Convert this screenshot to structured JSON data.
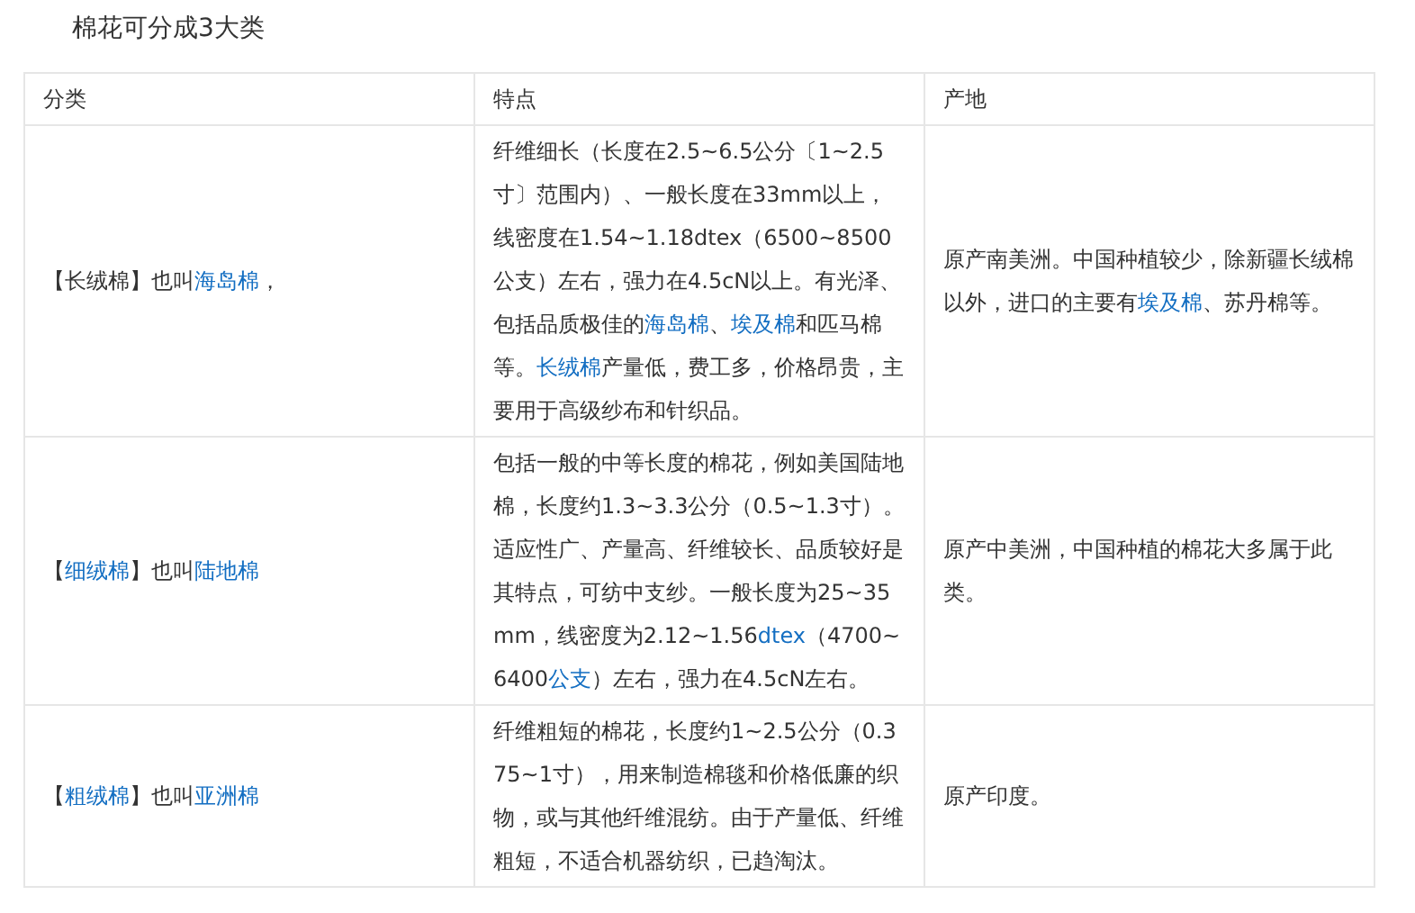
{
  "heading": "棉花可分成3大类",
  "table": {
    "columns": [
      "分类",
      "特点",
      "产地"
    ],
    "rows": [
      {
        "cells": [
          [
            {
              "text": "【长绒棉】也叫",
              "kind": "text"
            },
            {
              "text": "海岛棉",
              "kind": "link"
            },
            {
              "text": "，",
              "kind": "text"
            }
          ],
          [
            {
              "text": "纤维细长（长度在2.5~6.5公分〔1~2.5寸〕范围内）、一般长度在33mm以上，线密度在1.54~1.18dtex（6500~8500公支）左右，强力在4.5cN以上。有光泽、包括品质极佳的",
              "kind": "text"
            },
            {
              "text": "海岛棉",
              "kind": "link"
            },
            {
              "text": "、",
              "kind": "text"
            },
            {
              "text": "埃及棉",
              "kind": "link"
            },
            {
              "text": "和匹马棉等。",
              "kind": "text"
            },
            {
              "text": "长绒棉",
              "kind": "link"
            },
            {
              "text": "产量低，费工多，价格昂贵，主要用于高级纱布和针织品。",
              "kind": "text"
            }
          ],
          [
            {
              "text": "原产南美洲。中国种植较少，除新疆长绒棉以外，进口的主要有",
              "kind": "text"
            },
            {
              "text": "埃及棉",
              "kind": "link"
            },
            {
              "text": "、苏丹棉等。",
              "kind": "text"
            }
          ]
        ]
      },
      {
        "cells": [
          [
            {
              "text": "【",
              "kind": "text"
            },
            {
              "text": "细绒棉",
              "kind": "link"
            },
            {
              "text": "】也叫",
              "kind": "text"
            },
            {
              "text": "陆地棉",
              "kind": "link"
            }
          ],
          [
            {
              "text": "包括一般的中等长度的棉花，例如美国陆地棉，长度约1.3~3.3公分（0.5~1.3寸）。适应性广、产量高、纤维较长、品质较好是其特点，可纺中支纱。一般长度为25~35mm，线密度为2.12~1.56",
              "kind": "text"
            },
            {
              "text": "dtex",
              "kind": "link"
            },
            {
              "text": "（4700~6400",
              "kind": "text"
            },
            {
              "text": "公支",
              "kind": "link"
            },
            {
              "text": "）左右，强力在4.5cN左右。",
              "kind": "text"
            }
          ],
          [
            {
              "text": "原产中美洲，中国种植的棉花大多属于此类。",
              "kind": "text"
            }
          ]
        ]
      },
      {
        "cells": [
          [
            {
              "text": "【",
              "kind": "text"
            },
            {
              "text": "粗绒棉",
              "kind": "link"
            },
            {
              "text": "】也叫",
              "kind": "text"
            },
            {
              "text": "亚洲棉",
              "kind": "link"
            }
          ],
          [
            {
              "text": "纤维粗短的棉花，长度约1~2.5公分（0.375~1寸），用来制造棉毯和价格低廉的织物，或与其他纤维混纺。由于产量低、纤维粗短，不适合机器纺织，已趋淘汰。",
              "kind": "text"
            }
          ],
          [
            {
              "text": "原产印度。",
              "kind": "text"
            }
          ]
        ]
      }
    ]
  }
}
